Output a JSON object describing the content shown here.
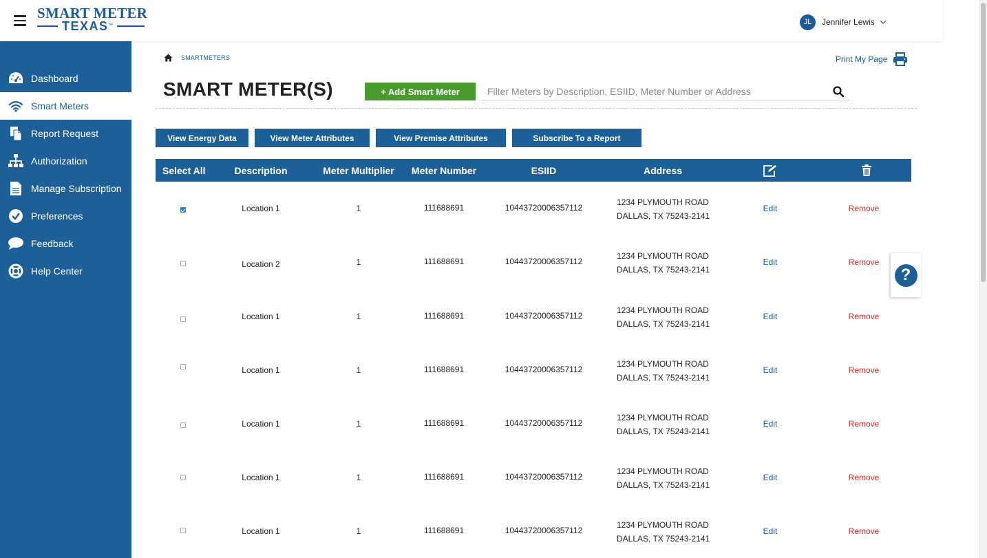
{
  "header": {
    "logo_line1": "SMART METER",
    "logo_line2": "TEXAS",
    "logo_tm": "™",
    "user_initials": "JL",
    "user_name": "Jennifer Lewis"
  },
  "sidebar": {
    "items": [
      {
        "label": "Dashboard",
        "icon": "dashboard-gauge-icon",
        "active": false
      },
      {
        "label": "Smart Meters",
        "icon": "wifi-icon",
        "active": true
      },
      {
        "label": "Report Request",
        "icon": "documents-icon",
        "active": false
      },
      {
        "label": "Authorization",
        "icon": "org-chart-icon",
        "active": false
      },
      {
        "label": "Manage Subscription",
        "icon": "file-icon",
        "active": false
      },
      {
        "label": "Preferences",
        "icon": "check-circle-icon",
        "active": false
      },
      {
        "label": "Feedback",
        "icon": "speech-bubble-icon",
        "active": false
      },
      {
        "label": "Help Center",
        "icon": "life-ring-icon",
        "active": false
      }
    ]
  },
  "breadcrumb": {
    "label": "SMARTMETERS"
  },
  "print_label": "Print My Page",
  "page_title": "SMART METER(S)",
  "add_button_label": "+ Add Smart Meter",
  "search": {
    "placeholder": "Filter Meters by Description, ESIID, Meter Number or Address",
    "value": ""
  },
  "actions": [
    "View Energy Data",
    "View Meter Attributes",
    "View Premise Attributes",
    "Subscribe To a Report"
  ],
  "table": {
    "headers": {
      "select_all": "Select All",
      "description": "Description",
      "multiplier": "Meter Multiplier",
      "meter_number": "Meter Number",
      "esiid": "ESIID",
      "address": "Address"
    },
    "edit_label": "Edit",
    "remove_label": "Remove",
    "rows": [
      {
        "checked": true,
        "description": "Location 1",
        "multiplier": "1",
        "meter_number": "111688691",
        "esiid": "10443720006357112",
        "address_line1": "1234 PLYMOUTH ROAD",
        "address_line2": "DALLAS, TX 75243-2141"
      },
      {
        "checked": false,
        "description": "Location 2",
        "multiplier": "1",
        "meter_number": "111688691",
        "esiid": "10443720006357112",
        "address_line1": "1234 PLYMOUTH ROAD",
        "address_line2": "DALLAS, TX 75243-2141"
      },
      {
        "checked": false,
        "description": "Location 1",
        "multiplier": "1",
        "meter_number": "111688691",
        "esiid": "10443720006357112",
        "address_line1": "1234 PLYMOUTH ROAD",
        "address_line2": "DALLAS, TX 75243-2141"
      },
      {
        "checked": false,
        "description": "Location 1",
        "multiplier": "1",
        "meter_number": "111688691",
        "esiid": "10443720006357112",
        "address_line1": "1234 PLYMOUTH ROAD",
        "address_line2": "DALLAS, TX 75243-2141"
      },
      {
        "checked": false,
        "description": "Location 1",
        "multiplier": "1",
        "meter_number": "111688691",
        "esiid": "10443720006357112",
        "address_line1": "1234 PLYMOUTH ROAD",
        "address_line2": "DALLAS, TX 75243-2141"
      },
      {
        "checked": false,
        "description": "Location 1",
        "multiplier": "1",
        "meter_number": "111688691",
        "esiid": "10443720006357112",
        "address_line1": "1234 PLYMOUTH ROAD",
        "address_line2": "DALLAS, TX 75243-2141"
      },
      {
        "checked": false,
        "description": "Location 1",
        "multiplier": "1",
        "meter_number": "111688691",
        "esiid": "10443720006357112",
        "address_line1": "1234 PLYMOUTH ROAD",
        "address_line2": "DALLAS, TX 75243-2141"
      }
    ]
  },
  "help_label": "?",
  "colors": {
    "brand_blue": "#1d6098",
    "add_green": "#4a9a30",
    "remove_red": "#e02424"
  }
}
